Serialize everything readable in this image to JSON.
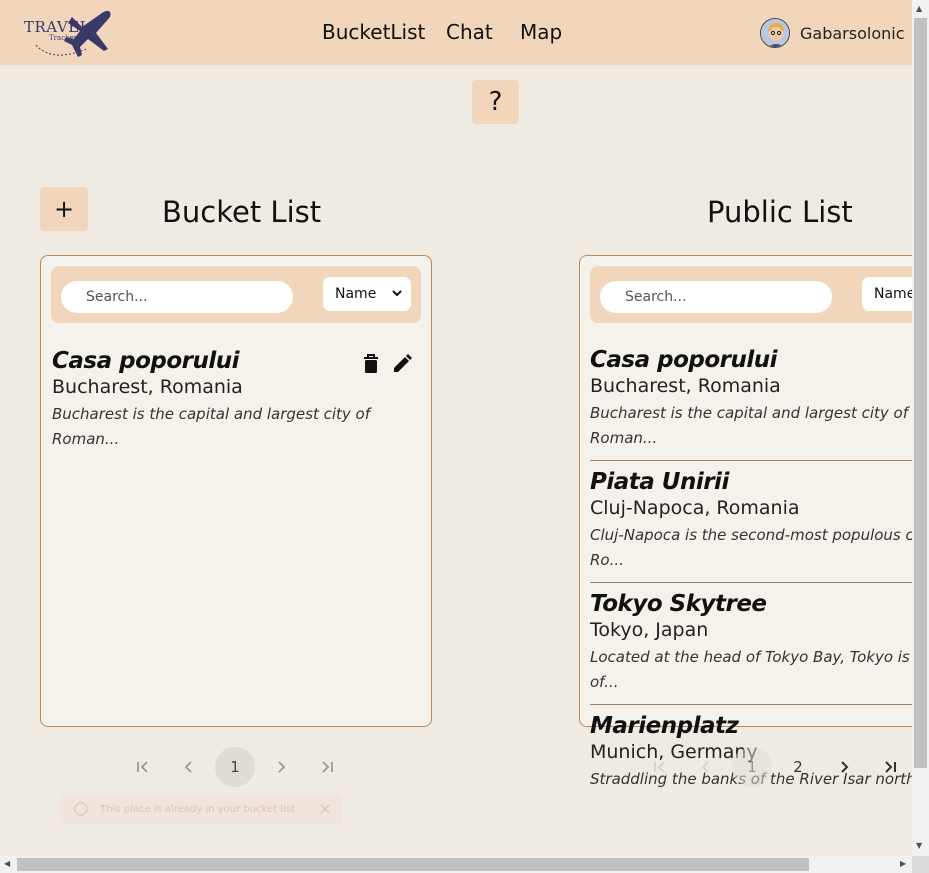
{
  "header": {
    "logo_line1": "TRAVEL",
    "logo_line2": "Tracker",
    "nav": [
      "BucketList",
      "Chat",
      "Map"
    ],
    "username": "Gabarsolonic"
  },
  "help_label": "?",
  "add_label": "+",
  "bucket": {
    "title": "Bucket List",
    "search_placeholder": "Search...",
    "sort_value": "Name",
    "items": [
      {
        "name": "Casa poporului",
        "location": "Bucharest, Romania",
        "desc1": "Bucharest is the capital and largest city of",
        "desc2": "Roman..."
      }
    ],
    "pagination": {
      "current": "1"
    }
  },
  "public": {
    "title": "Public List",
    "search_placeholder": "Search...",
    "sort_value": "Name",
    "items": [
      {
        "name": "Casa poporului",
        "location": "Bucharest, Romania",
        "desc1": "Bucharest is the capital and largest city of",
        "desc2": "Roman..."
      },
      {
        "name": "Piata Unirii",
        "location": "Cluj-Napoca, Romania",
        "desc1": "Cluj-Napoca is the second-most populous ci",
        "desc2": "Ro..."
      },
      {
        "name": "Tokyo Skytree",
        "location": "Tokyo, Japan",
        "desc1": "Located at the head of Tokyo Bay, Tokyo is",
        "desc2": "of..."
      },
      {
        "name": "Marienplatz",
        "location": "Munich, Germany",
        "desc1": "Straddling the banks of the River Isar north"
      }
    ],
    "pagination": {
      "current": "1",
      "next": "2"
    }
  },
  "toast": "This place is already in your bucket list",
  "colors": {
    "accent": "#f2d6bb",
    "background": "#efebe3",
    "panel_border": "#b98a5e"
  }
}
